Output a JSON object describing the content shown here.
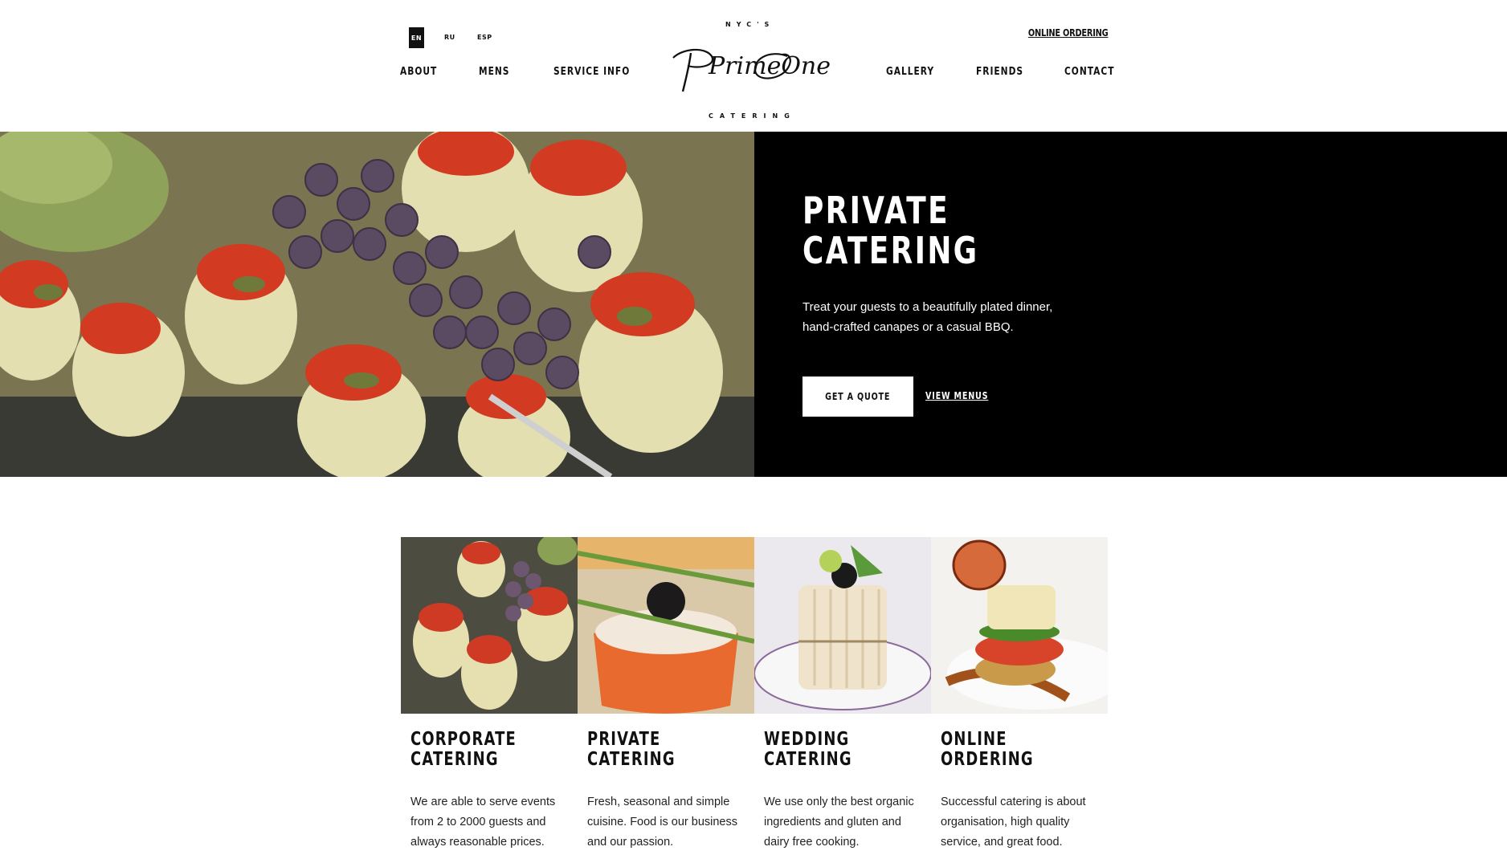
{
  "header": {
    "languages": [
      "EN",
      "RU",
      "ESP"
    ],
    "online_ordering": "ONLINE ORDERING",
    "nav_left": [
      "ABOUT",
      "MENS",
      "SERVICE INFO"
    ],
    "nav_right": [
      "GALLERY",
      "FRIENDS",
      "CONTACT"
    ],
    "logo": {
      "top": "NYC'S",
      "script": "PrimeOne",
      "bottom": "CATERING"
    }
  },
  "hero": {
    "title_line1": "PRIVATE",
    "title_line2": "CATERING",
    "description": "Treat your guests to a beautifully plated dinner, hand-crafted canapes or a casual BBQ.",
    "quote_button": "GET A QUOTE",
    "menus_link": "VIEW MENUS"
  },
  "cards": [
    {
      "title_line1": "CORPORATE",
      "title_line2": "CATERING",
      "text": "We are able to serve events from 2 to 2000 guests and always reasonable prices."
    },
    {
      "title_line1": "PRIVATE",
      "title_line2": "CATERING",
      "text": "Fresh, seasonal and simple cuisine. Food is our business and our passion."
    },
    {
      "title_line1": "WEDDING",
      "title_line2": "CATERING",
      "text": "We use only the best organic ingredients and gluten and dairy free cooking."
    },
    {
      "title_line1": "ONLINE",
      "title_line2": "ORDERING",
      "text": "Successful catering is about organisation, high quality service, and great food."
    }
  ],
  "colors": {
    "background": "#ffffff",
    "panel": "#000000",
    "text": "#111111"
  }
}
